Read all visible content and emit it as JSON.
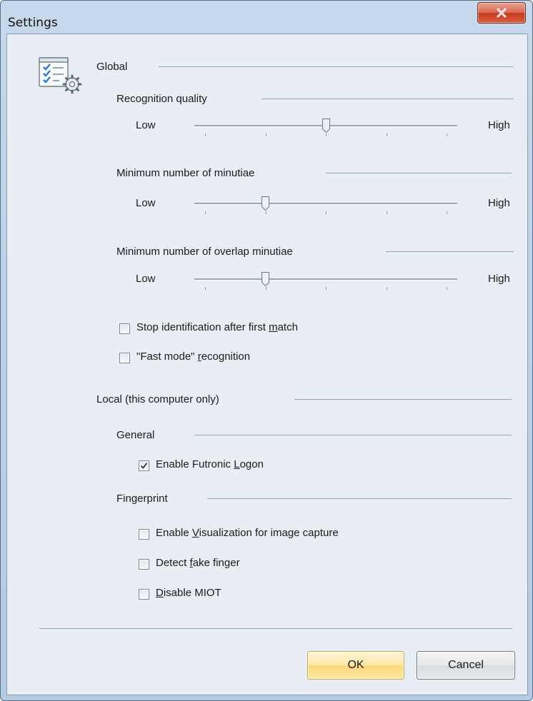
{
  "window": {
    "title": "Settings",
    "close_icon": "close-icon"
  },
  "global": {
    "heading": "Global",
    "icon": "settings-checklist-gear-icon",
    "sliders": [
      {
        "label": "Recognition quality",
        "low": "Low",
        "high": "High",
        "ticks": 5,
        "position": 2
      },
      {
        "label": "Minimum number of minutiae",
        "low": "Low",
        "high": "High",
        "ticks": 5,
        "position": 1
      },
      {
        "label": "Minimum number of overlap minutiae",
        "low": "Low",
        "high": "High",
        "ticks": 5,
        "position": 1
      }
    ],
    "checkboxes": [
      {
        "pre": "Stop identification after first ",
        "acc": "m",
        "post": "atch",
        "checked": false
      },
      {
        "pre": "\"Fast mode\" ",
        "acc": "r",
        "post": "ecognition",
        "checked": false
      }
    ]
  },
  "local": {
    "heading": "Local (this computer only)",
    "general": {
      "heading": "General",
      "checkboxes": [
        {
          "pre": "Enable Futronic ",
          "acc": "L",
          "post": "ogon",
          "checked": true
        }
      ]
    },
    "fingerprint": {
      "heading": "Fingerprint",
      "checkboxes": [
        {
          "pre": "Enable ",
          "acc": "V",
          "post": "isualization for image capture",
          "checked": false
        },
        {
          "pre": "Detect ",
          "acc": "f",
          "post": "ake finger",
          "checked": false
        },
        {
          "pre": "",
          "acc": "D",
          "post": "isable MIOT",
          "checked": false
        }
      ]
    }
  },
  "buttons": {
    "ok": "OK",
    "cancel": "Cancel"
  }
}
